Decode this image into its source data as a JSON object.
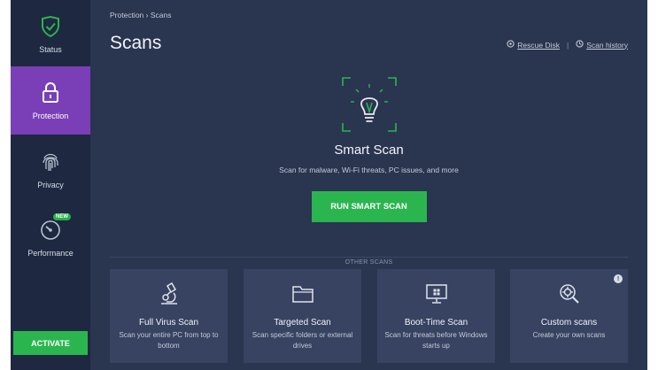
{
  "sidebar": {
    "items": [
      {
        "label": "Status",
        "icon": "shield-check-icon"
      },
      {
        "label": "Protection",
        "icon": "lock-icon"
      },
      {
        "label": "Privacy",
        "icon": "fingerprint-icon"
      },
      {
        "label": "Performance",
        "icon": "speedometer-icon",
        "badge": "NEW"
      }
    ],
    "activate_label": "ACTIVATE"
  },
  "header": {
    "breadcrumb": "Protection › Scans",
    "title": "Scans",
    "links": [
      {
        "label": "Rescue Disk",
        "icon": "rescue-disk-icon"
      },
      {
        "label": "Scan history",
        "icon": "history-icon"
      }
    ]
  },
  "smart_scan": {
    "title": "Smart Scan",
    "subtitle": "Scan for malware, Wi-Fi threats, PC issues, and more",
    "button_label": "RUN SMART SCAN",
    "icon": "lightbulb-icon"
  },
  "other_scans": {
    "label": "OTHER SCANS",
    "cards": [
      {
        "title": "Full Virus Scan",
        "desc": "Scan your entire PC from top to bottom",
        "icon": "microscope-icon"
      },
      {
        "title": "Targeted Scan",
        "desc": "Scan specific folders or external drives",
        "icon": "folder-icon"
      },
      {
        "title": "Boot-Time Scan",
        "desc": "Scan for threats before Windows starts up",
        "icon": "monitor-icon"
      },
      {
        "title": "Custom scans",
        "desc": "Create your own scans",
        "icon": "gear-search-icon"
      }
    ]
  },
  "colors": {
    "accent_green": "#2bb54f",
    "active_purple": "#7a3fb6",
    "background": "#2a3550",
    "sidebar": "#1e2840",
    "card": "#374361"
  }
}
